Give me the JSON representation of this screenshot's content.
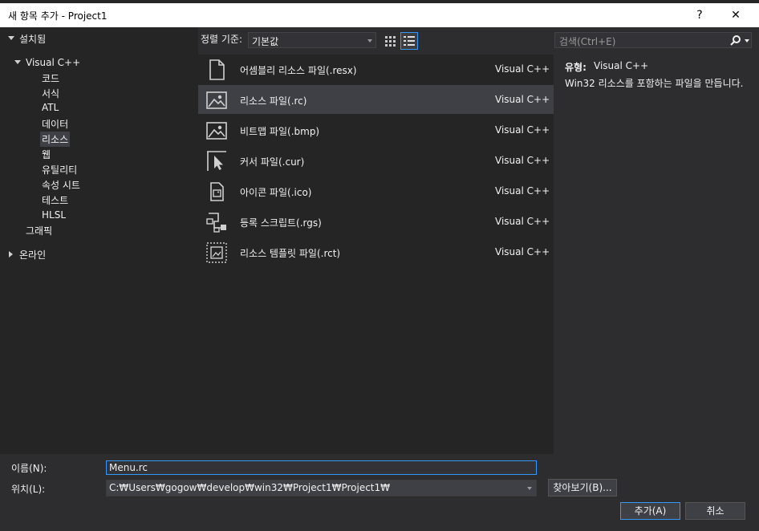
{
  "window": {
    "title": "새 항목 추가 - Project1",
    "help": "?",
    "close": "✕"
  },
  "tree": {
    "installed": "설치됨",
    "visual_cpp": "Visual C++",
    "children": [
      "코드",
      "서식",
      "ATL",
      "데이터",
      "리소스",
      "웹",
      "유틸리티",
      "속성 시트",
      "테스트",
      "HLSL"
    ],
    "graphics": "그래픽",
    "online": "온라인",
    "selected_child": "리소스"
  },
  "toolbar": {
    "sort_label": "정렬 기준:",
    "sort_value": "기본값",
    "search_placeholder": "검색(Ctrl+E)"
  },
  "items": [
    {
      "name": "어셈블리 리소스 파일(.resx)",
      "lang": "Visual C++",
      "icon": "document-icon"
    },
    {
      "name": "리소스 파일(.rc)",
      "lang": "Visual C++",
      "icon": "image-icon"
    },
    {
      "name": "비트맵 파일(.bmp)",
      "lang": "Visual C++",
      "icon": "image-icon"
    },
    {
      "name": "커서 파일(.cur)",
      "lang": "Visual C++",
      "icon": "cursor-icon"
    },
    {
      "name": "아이콘 파일(.ico)",
      "lang": "Visual C++",
      "icon": "icon-file-icon"
    },
    {
      "name": "등록 스크립트(.rgs)",
      "lang": "Visual C++",
      "icon": "registry-icon"
    },
    {
      "name": "리소스 템플릿 파일(.rct)",
      "lang": "Visual C++",
      "icon": "template-icon"
    }
  ],
  "details": {
    "type_label": "유형:",
    "type_value": "Visual C++",
    "description": "Win32 리소스를 포함하는 파일을 만듭니다."
  },
  "form": {
    "name_label": "이름(N):",
    "name_value": "Menu.rc",
    "location_label": "위치(L):",
    "location_value": "C:₩Users₩gogow₩develop₩win32₩Project1₩Project1₩",
    "browse": "찾아보기(B)...",
    "add": "추가(A)",
    "cancel": "취소"
  },
  "colors": {
    "accent": "#3399ff",
    "background": "#2d2d30",
    "panel": "#252526",
    "selection": "#3f3f46"
  }
}
